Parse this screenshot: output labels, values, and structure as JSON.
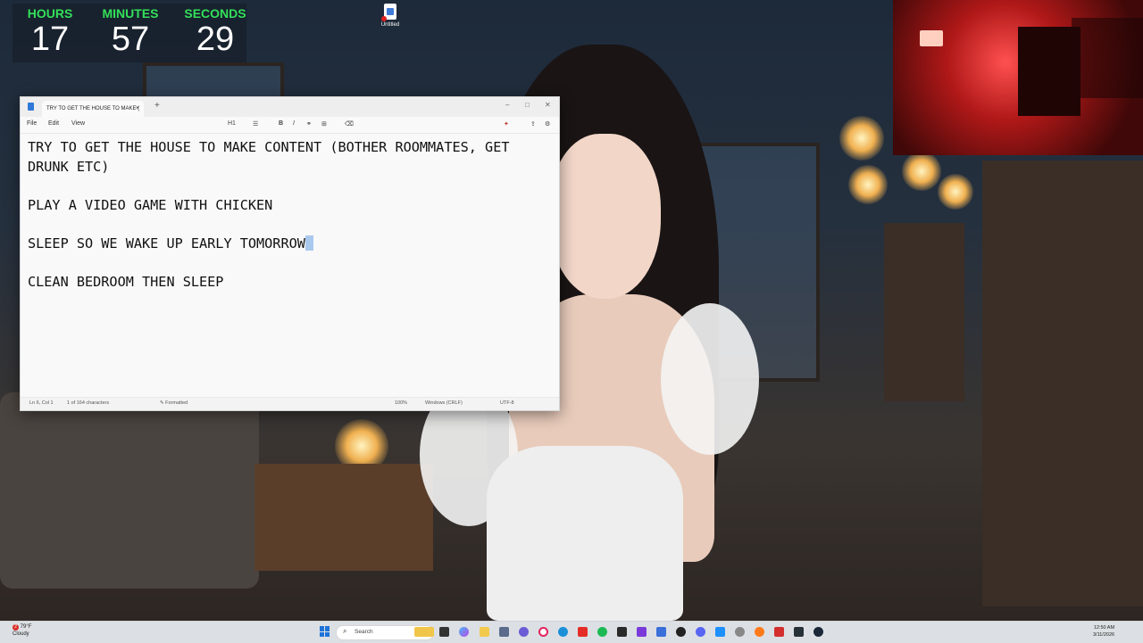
{
  "clock": {
    "hours_label": "HOURS",
    "hours": "17",
    "minutes_label": "MINUTES",
    "minutes": "57",
    "seconds_label": "SECONDS",
    "seconds": "29"
  },
  "desktop": {
    "icon_label": "Untitled"
  },
  "notepad": {
    "tab_title": "TRY TO GET THE HOUSE TO MAKE (",
    "tab_close": "×",
    "tab_add": "+",
    "window_min": "–",
    "window_max": "□",
    "window_close": "✕",
    "menu": {
      "file": "File",
      "edit": "Edit",
      "view": "View"
    },
    "toolbar": {
      "heading": "H1",
      "list": "☰",
      "bold": "B",
      "italic": "I",
      "link": "⚭",
      "table": "⊞",
      "clear": "⌫",
      "copilot": "✦",
      "share": "⇪",
      "settings": "⚙"
    },
    "lines": [
      "TRY TO GET THE HOUSE TO MAKE CONTENT (BOTHER ROOMMATES, GET DRUNK ETC)",
      "PLAY A VIDEO GAME WITH CHICKEN",
      "SLEEP SO WE WAKE UP EARLY TOMORROW",
      "CLEAN BEDROOM THEN SLEEP"
    ],
    "status": {
      "position": "Ln 6, Col 1",
      "chars": "1 of 164 characters",
      "format": "Formatted",
      "zoom": "100%",
      "line_ending": "Windows (CRLF)",
      "encoding": "UTF-8"
    }
  },
  "taskbar": {
    "weather_temp": "79°F",
    "weather_desc": "Cloudy",
    "notification_count": "2",
    "search_placeholder": "Search",
    "time": "12:50 AM",
    "date": "3/11/2026"
  },
  "colors": {
    "clock_label": "#33e05a",
    "accent": "#1f73d9",
    "selection": "#a9c8ee"
  }
}
